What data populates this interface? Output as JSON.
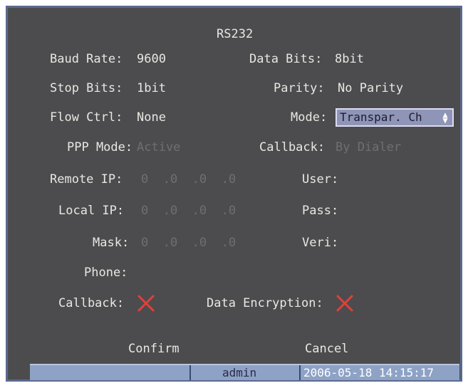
{
  "title": "RS232",
  "fields": {
    "baud_rate_label": "Baud Rate:",
    "baud_rate_value": "9600",
    "data_bits_label": "Data Bits:",
    "data_bits_value": "8bit",
    "stop_bits_label": "Stop Bits:",
    "stop_bits_value": "1bit",
    "parity_label": "Parity:",
    "parity_value": "No Parity",
    "flow_ctrl_label": "Flow Ctrl:",
    "flow_ctrl_value": "None",
    "mode_label": "Mode:",
    "mode_value": "Transpar. Ch",
    "ppp_mode_label": "PPP Mode:",
    "ppp_mode_value": "Active",
    "callback_mode_label": "Callback:",
    "callback_mode_value": "By Dialer",
    "remote_ip_label": "Remote IP:",
    "remote_ip_value": "0  .0  .0  .0",
    "user_label": "User:",
    "local_ip_label": "Local IP:",
    "local_ip_value": "0  .0  .0  .0",
    "pass_label": "Pass:",
    "mask_label": "Mask:",
    "mask_value": "0  .0  .0  .0",
    "veri_label": "Veri:",
    "phone_label": "Phone:",
    "callback_label": "Callback:",
    "callback_checked": false,
    "data_encryption_label": "Data Encryption:",
    "data_encryption_checked": false
  },
  "buttons": {
    "confirm": "Confirm",
    "cancel": "Cancel"
  },
  "status_bar": {
    "user": "admin",
    "datetime": "2006-05-18 14:15:17"
  },
  "colors": {
    "background": "#4c4c4e",
    "text": "#e7e7e3",
    "disabled_text": "#6f6f6f",
    "select_bg": "#8e95b7",
    "status_bar_bg": "#8ea2c6",
    "cross_mark": "#e0403a"
  },
  "icons": {
    "mode_dropdown": "up-down-arrows-icon",
    "unchecked_box": "red-cross-icon"
  }
}
